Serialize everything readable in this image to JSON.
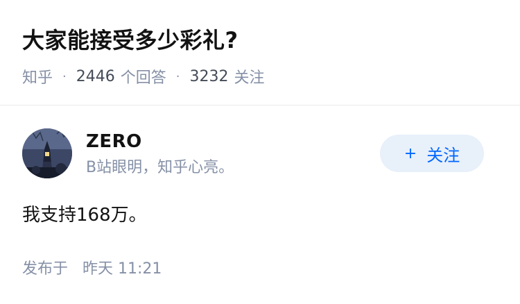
{
  "question": {
    "title": "大家能接受多少彩礼?",
    "source": "知乎",
    "answer_count": "2446",
    "answer_label": "个回答",
    "follower_count": "3232",
    "follower_label": "关注",
    "separator": "·"
  },
  "answer": {
    "author": {
      "name": "ZERO",
      "bio": "B站眼明，知乎心亮。",
      "avatar_icon": "avatar-night-tower-photo"
    },
    "follow_button": {
      "icon": "+",
      "label": "关注"
    },
    "content": "我支持168万。",
    "published_label": "发布于",
    "published_time": "昨天 11:21"
  },
  "colors": {
    "accent": "#0066ff",
    "follow_bg": "#e8f0fa",
    "meta_text": "#8590a6",
    "primary_text": "#121212"
  }
}
